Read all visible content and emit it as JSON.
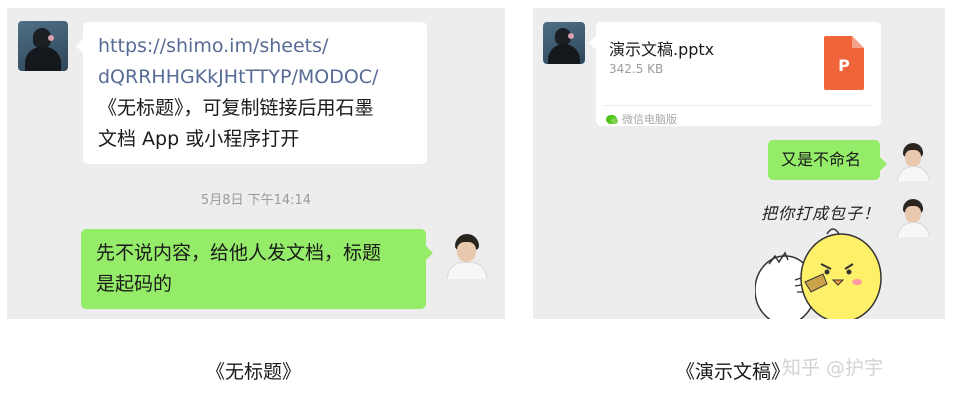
{
  "left_chat": {
    "incoming_message": {
      "link_line_1": "https://shimo.im/sheets/",
      "link_line_2": "dQRRHHGKkJHtTTYP/MODOC/",
      "text_line_1": "《无标题》，可复制链接后用石墨",
      "text_line_2": "文档 App 或小程序打开"
    },
    "timestamp": "5月8日 下午14:14",
    "outgoing_message": {
      "line_1": "先不说内容，给他人发文档，标题",
      "line_2": "是起码的"
    },
    "caption": "《无标题》"
  },
  "right_chat": {
    "file_card": {
      "file_name": "演示文稿.pptx",
      "file_size": "342.5 KB",
      "file_icon_letter": "P",
      "source": "微信电脑版",
      "icon": "pptx-file-icon",
      "icon_color": "#f0643a"
    },
    "outgoing_message": "又是不命名",
    "sticker_text": "把你打成包子！",
    "caption": "《演示文稿》",
    "watermark": "知乎 @护宇"
  },
  "colors": {
    "chat_background": "#ededed",
    "incoming_bubble": "#ffffff",
    "outgoing_bubble": "#95ec69",
    "link": "#576b95",
    "timestamp": "#9b9b9b"
  }
}
